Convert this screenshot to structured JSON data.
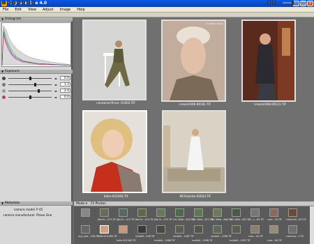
{
  "window": {
    "title": "Capture One 4.0"
  },
  "menu": [
    "File",
    "Edit",
    "View",
    "Adjust",
    "Image",
    "Help"
  ],
  "left_panel": {
    "histogram_title": "Histogram",
    "exposure_title": "Exposure",
    "exposure_values": [
      "0.0",
      "1.3",
      "2.4",
      "0.0"
    ],
    "metadata_title": "Metadata",
    "metadata": [
      {
        "label": "camera model",
        "value": "P 45"
      },
      {
        "label": "camera manufacturer",
        "value": "Phase One"
      }
    ]
  },
  "viewer": {
    "photos": [
      {
        "caption": "container/Anna- 01602.TIF"
      },
      {
        "caption": "cream2408-00181.TIF"
      },
      {
        "caption": "cream2408-00121.TIF"
      },
      {
        "caption": "Kalle-00156S.TIF"
      },
      {
        "caption": "MCO/white-00S04.TIF"
      }
    ],
    "watermark": "© Alberto Sende"
  },
  "browser": {
    "mode_label": "Mode",
    "count_label": "72 Photos",
    "row1_captions": [
      "",
      "Jibe Ih...472.TIF",
      "Jibe Ih...473.TIF",
      "Jibe Ih...474.TIF",
      "Jibe Ih...475.TIF",
      "Col. Web...456.TIF",
      "Col. Web...457.TIF",
      "Col. Web...466.TIF",
      "Col. Web...467.TIF",
      "c..._c...63.TIF",
      "crea...24.TIF",
      "creamrie...63.TIF"
    ],
    "row2_captions": [
      "m/a_sde...108.TIF",
      "kalle-00156S.TIF",
      "kalle-00156S.TIF",
      "inside0...456.TIF",
      "inside0...1086.TIF",
      "inside0...1087.TIF",
      "inside0...1098.TIF",
      "inside0...1098.TIF",
      "inside0...1097.TIF",
      "crea...45.TIF",
      "crea...46.TIF",
      "creamro...1.TIF"
    ]
  },
  "colors": {
    "titlebar": "#0a58e3",
    "panel": "#d8d8d8",
    "viewer_bg": "#707070",
    "selection": "#3b6fd6"
  }
}
